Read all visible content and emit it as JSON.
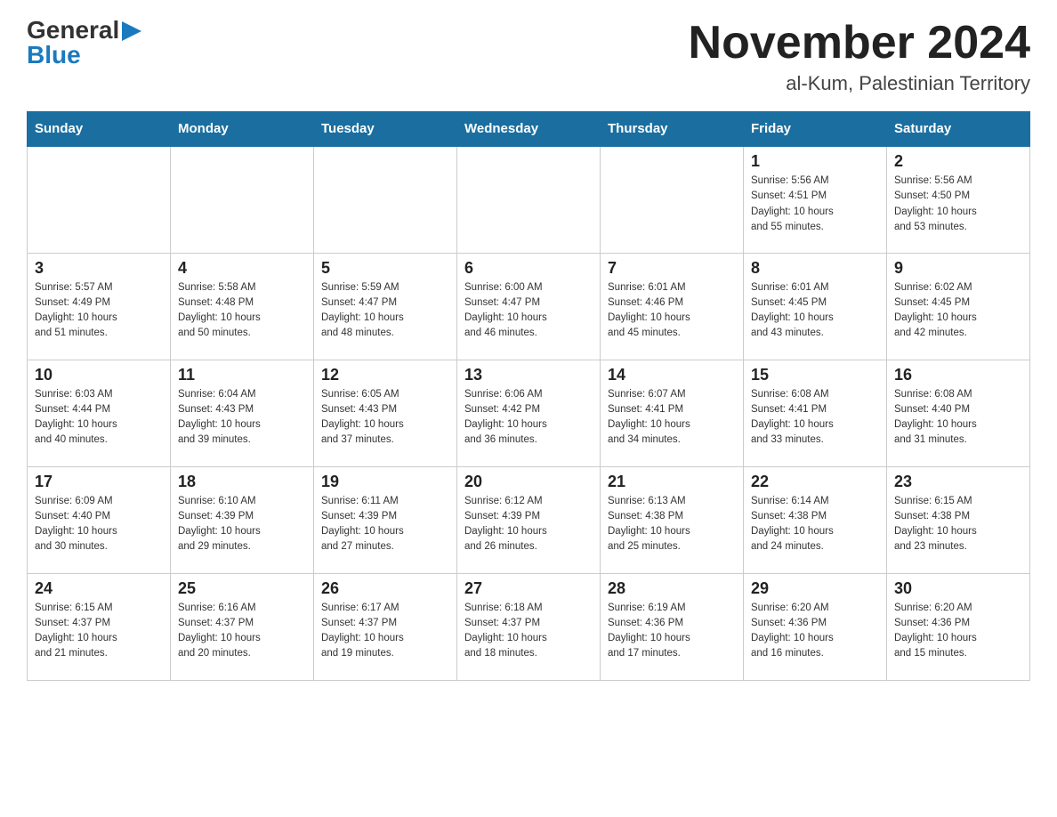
{
  "header": {
    "logo_general": "General",
    "logo_blue": "Blue",
    "month_title": "November 2024",
    "location": "al-Kum, Palestinian Territory"
  },
  "calendar": {
    "days_of_week": [
      "Sunday",
      "Monday",
      "Tuesday",
      "Wednesday",
      "Thursday",
      "Friday",
      "Saturday"
    ],
    "weeks": [
      {
        "cells": [
          {
            "day": "",
            "info": ""
          },
          {
            "day": "",
            "info": ""
          },
          {
            "day": "",
            "info": ""
          },
          {
            "day": "",
            "info": ""
          },
          {
            "day": "",
            "info": ""
          },
          {
            "day": "1",
            "info": "Sunrise: 5:56 AM\nSunset: 4:51 PM\nDaylight: 10 hours\nand 55 minutes."
          },
          {
            "day": "2",
            "info": "Sunrise: 5:56 AM\nSunset: 4:50 PM\nDaylight: 10 hours\nand 53 minutes."
          }
        ]
      },
      {
        "cells": [
          {
            "day": "3",
            "info": "Sunrise: 5:57 AM\nSunset: 4:49 PM\nDaylight: 10 hours\nand 51 minutes."
          },
          {
            "day": "4",
            "info": "Sunrise: 5:58 AM\nSunset: 4:48 PM\nDaylight: 10 hours\nand 50 minutes."
          },
          {
            "day": "5",
            "info": "Sunrise: 5:59 AM\nSunset: 4:47 PM\nDaylight: 10 hours\nand 48 minutes."
          },
          {
            "day": "6",
            "info": "Sunrise: 6:00 AM\nSunset: 4:47 PM\nDaylight: 10 hours\nand 46 minutes."
          },
          {
            "day": "7",
            "info": "Sunrise: 6:01 AM\nSunset: 4:46 PM\nDaylight: 10 hours\nand 45 minutes."
          },
          {
            "day": "8",
            "info": "Sunrise: 6:01 AM\nSunset: 4:45 PM\nDaylight: 10 hours\nand 43 minutes."
          },
          {
            "day": "9",
            "info": "Sunrise: 6:02 AM\nSunset: 4:45 PM\nDaylight: 10 hours\nand 42 minutes."
          }
        ]
      },
      {
        "cells": [
          {
            "day": "10",
            "info": "Sunrise: 6:03 AM\nSunset: 4:44 PM\nDaylight: 10 hours\nand 40 minutes."
          },
          {
            "day": "11",
            "info": "Sunrise: 6:04 AM\nSunset: 4:43 PM\nDaylight: 10 hours\nand 39 minutes."
          },
          {
            "day": "12",
            "info": "Sunrise: 6:05 AM\nSunset: 4:43 PM\nDaylight: 10 hours\nand 37 minutes."
          },
          {
            "day": "13",
            "info": "Sunrise: 6:06 AM\nSunset: 4:42 PM\nDaylight: 10 hours\nand 36 minutes."
          },
          {
            "day": "14",
            "info": "Sunrise: 6:07 AM\nSunset: 4:41 PM\nDaylight: 10 hours\nand 34 minutes."
          },
          {
            "day": "15",
            "info": "Sunrise: 6:08 AM\nSunset: 4:41 PM\nDaylight: 10 hours\nand 33 minutes."
          },
          {
            "day": "16",
            "info": "Sunrise: 6:08 AM\nSunset: 4:40 PM\nDaylight: 10 hours\nand 31 minutes."
          }
        ]
      },
      {
        "cells": [
          {
            "day": "17",
            "info": "Sunrise: 6:09 AM\nSunset: 4:40 PM\nDaylight: 10 hours\nand 30 minutes."
          },
          {
            "day": "18",
            "info": "Sunrise: 6:10 AM\nSunset: 4:39 PM\nDaylight: 10 hours\nand 29 minutes."
          },
          {
            "day": "19",
            "info": "Sunrise: 6:11 AM\nSunset: 4:39 PM\nDaylight: 10 hours\nand 27 minutes."
          },
          {
            "day": "20",
            "info": "Sunrise: 6:12 AM\nSunset: 4:39 PM\nDaylight: 10 hours\nand 26 minutes."
          },
          {
            "day": "21",
            "info": "Sunrise: 6:13 AM\nSunset: 4:38 PM\nDaylight: 10 hours\nand 25 minutes."
          },
          {
            "day": "22",
            "info": "Sunrise: 6:14 AM\nSunset: 4:38 PM\nDaylight: 10 hours\nand 24 minutes."
          },
          {
            "day": "23",
            "info": "Sunrise: 6:15 AM\nSunset: 4:38 PM\nDaylight: 10 hours\nand 23 minutes."
          }
        ]
      },
      {
        "cells": [
          {
            "day": "24",
            "info": "Sunrise: 6:15 AM\nSunset: 4:37 PM\nDaylight: 10 hours\nand 21 minutes."
          },
          {
            "day": "25",
            "info": "Sunrise: 6:16 AM\nSunset: 4:37 PM\nDaylight: 10 hours\nand 20 minutes."
          },
          {
            "day": "26",
            "info": "Sunrise: 6:17 AM\nSunset: 4:37 PM\nDaylight: 10 hours\nand 19 minutes."
          },
          {
            "day": "27",
            "info": "Sunrise: 6:18 AM\nSunset: 4:37 PM\nDaylight: 10 hours\nand 18 minutes."
          },
          {
            "day": "28",
            "info": "Sunrise: 6:19 AM\nSunset: 4:36 PM\nDaylight: 10 hours\nand 17 minutes."
          },
          {
            "day": "29",
            "info": "Sunrise: 6:20 AM\nSunset: 4:36 PM\nDaylight: 10 hours\nand 16 minutes."
          },
          {
            "day": "30",
            "info": "Sunrise: 6:20 AM\nSunset: 4:36 PM\nDaylight: 10 hours\nand 15 minutes."
          }
        ]
      }
    ]
  }
}
